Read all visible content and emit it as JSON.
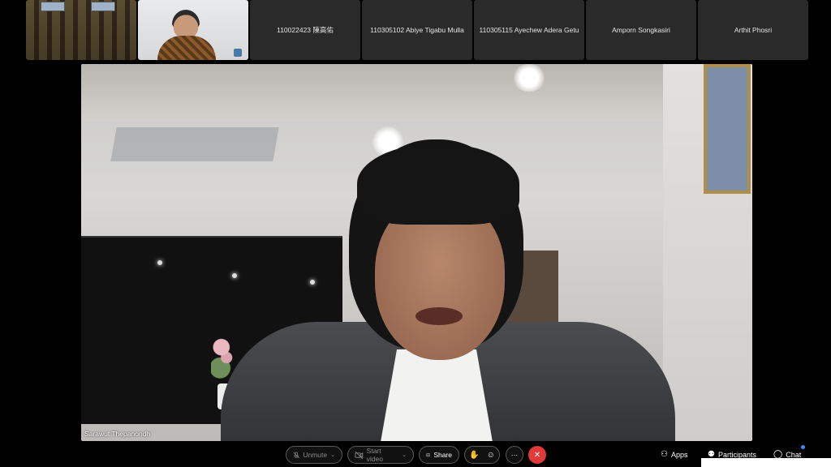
{
  "participants_strip": [
    {
      "type": "video",
      "label": ""
    },
    {
      "type": "video",
      "label": ""
    },
    {
      "type": "name",
      "label": "110022423 陳高佑"
    },
    {
      "type": "name",
      "label": "110305102 Abiye Tigabu Mulla"
    },
    {
      "type": "name",
      "label": "110305115 Ayechew Adera Getu"
    },
    {
      "type": "name",
      "label": "Amporn Songkasiri"
    },
    {
      "type": "name",
      "label": "Arthit Phosri"
    }
  ],
  "active_speaker": {
    "name": "Sarawut Thepanondh"
  },
  "toolbar": {
    "unmute_label": "Unmute",
    "start_video_label": "Start video",
    "share_label": "Share",
    "apps_label": "Apps",
    "participants_label": "Participants",
    "chat_label": "Chat"
  },
  "colors": {
    "leave": "#e03a3a",
    "notify": "#3b8cff"
  }
}
